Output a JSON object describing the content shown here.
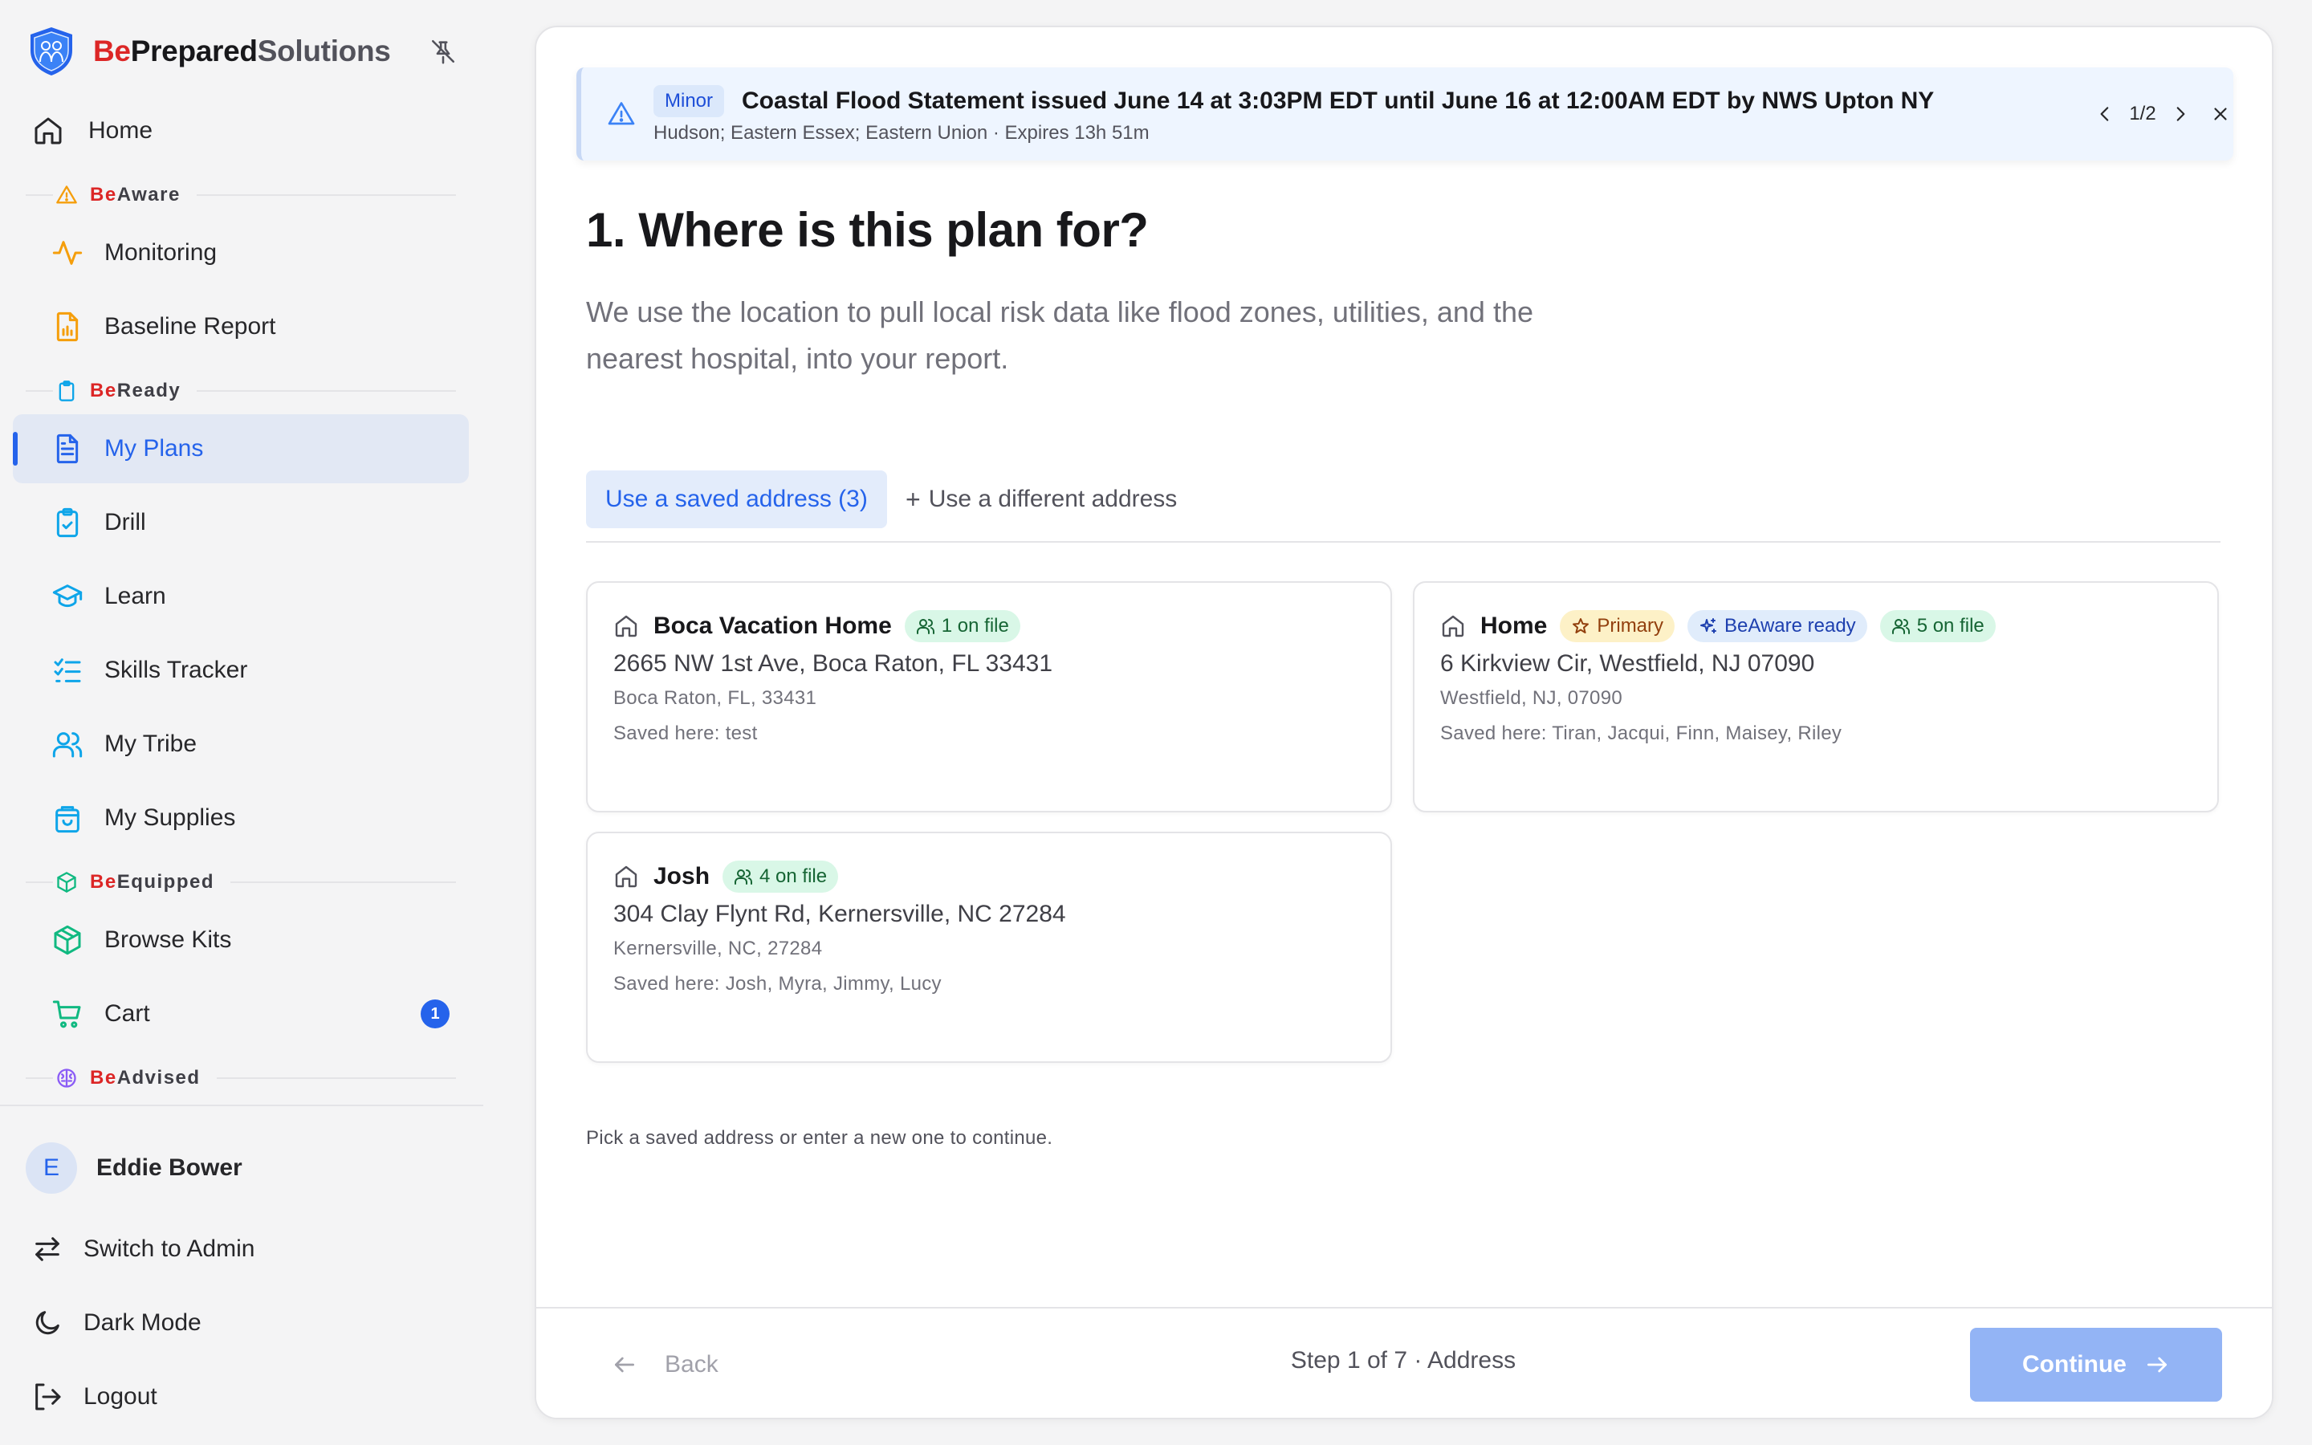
{
  "brand": {
    "be": "Be",
    "prepared": "Prepared",
    "solutions": "Solutions"
  },
  "sidebar": {
    "home": "Home",
    "sections": {
      "aware": {
        "be": "Be",
        "rest": "Aware"
      },
      "ready": {
        "be": "Be",
        "rest": "Ready"
      },
      "equipped": {
        "be": "Be",
        "rest": "Equipped"
      },
      "advised": {
        "be": "Be",
        "rest": "Advised"
      }
    },
    "items": {
      "monitoring": "Monitoring",
      "baseline_report": "Baseline Report",
      "my_plans": "My Plans",
      "drill": "Drill",
      "learn": "Learn",
      "skills_tracker": "Skills Tracker",
      "my_tribe": "My Tribe",
      "my_supplies": "My Supplies",
      "browse_kits": "Browse Kits",
      "cart": "Cart"
    },
    "cart_count": "1",
    "user": {
      "initial": "E",
      "name": "Eddie Bower"
    },
    "bottom": {
      "switch_admin": "Switch to Admin",
      "dark_mode": "Dark Mode",
      "logout": "Logout"
    }
  },
  "alert": {
    "severity": "Minor",
    "title": "Coastal Flood Statement issued June 14 at 3:03PM EDT until June 16 at 12:00AM EDT by NWS Upton NY",
    "subtitle": "Hudson; Eastern Essex; Eastern Union · Expires 13h 51m",
    "page": "1/2"
  },
  "main": {
    "title": "1. Where is this plan for?",
    "description": "We use the location to pull local risk data like flood zones, utilities, and the nearest hospital, into your report.",
    "tabs": {
      "saved": "Use a saved address (3)",
      "new": "Use a different address"
    },
    "hint": "Pick a saved address or enter a new one to continue."
  },
  "addresses": [
    {
      "name": "Boca Vacation Home",
      "on_file": "1 on file",
      "street": "2665 NW 1st Ave, Boca Raton, FL 33431",
      "city": "Boca Raton, FL, 33431",
      "saved": "Saved here: test"
    },
    {
      "name": "Home",
      "primary": "Primary",
      "beaware": "BeAware ready",
      "on_file": "5 on file",
      "street": "6 Kirkview Cir, Westfield, NJ 07090",
      "city": "Westfield, NJ, 07090",
      "saved": "Saved here: Tiran, Jacqui, Finn, Maisey, Riley"
    },
    {
      "name": "Josh",
      "on_file": "4 on file",
      "street": "304 Clay Flynt Rd, Kernersville, NC 27284",
      "city": "Kernersville, NC, 27284",
      "saved": "Saved here: Josh, Myra, Jimmy, Lucy"
    }
  ],
  "footer": {
    "back": "Back",
    "step": "Step 1 of 7 · Address",
    "continue": "Continue"
  },
  "colors": {
    "accent": "#2563eb",
    "brand_red": "#dc2626",
    "aware_orange": "#f59e0b",
    "ready_blue": "#0ea5e9",
    "equipped_green": "#10b981",
    "advised_purple": "#8b5cf6"
  }
}
